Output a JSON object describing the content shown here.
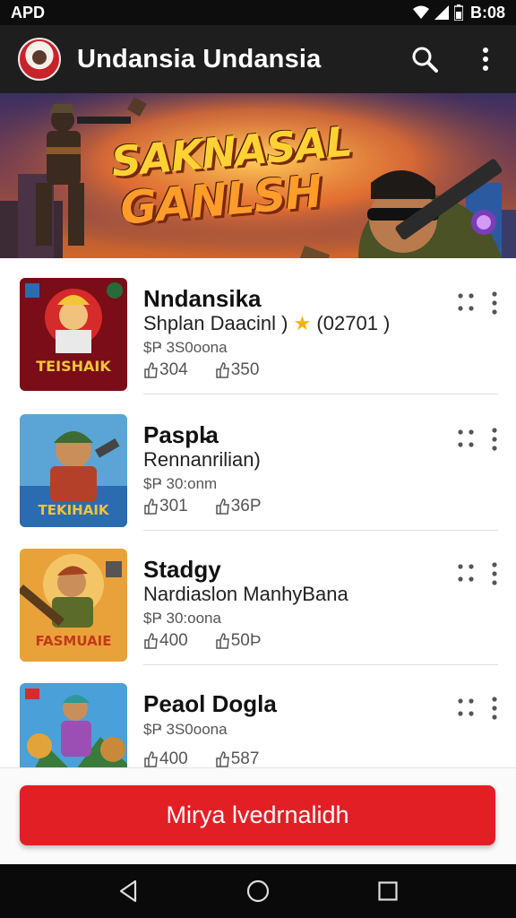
{
  "status_bar": {
    "left_text": "APD",
    "time": "B:08",
    "icons": [
      "wifi-icon",
      "signal-icon",
      "battery-icon"
    ]
  },
  "app_bar": {
    "title": "Undansia Undansia",
    "actions": [
      "search-icon",
      "more-vert-icon"
    ]
  },
  "banner": {
    "title_line1": "SAKNASAL",
    "title_line2": "GANLSH"
  },
  "games": [
    {
      "title": "Nndansika",
      "subtitle_prefix": "Shplan Daacinl )",
      "rating_icon": "star-icon",
      "rating_text": "(02701 )",
      "meta": "$Ҏ 3S0oona",
      "stat1": "304",
      "stat2": "350",
      "thumb_text": "TEISHAIK",
      "thumb_colors": [
        "#7a0d18",
        "#d62b2b",
        "#f2c43a"
      ]
    },
    {
      "title": "Paspl̵a",
      "subtitle_prefix": "Rennanrilian)",
      "meta": "$Ҏ 30:onm",
      "stat1": "301",
      "stat2": "36P",
      "thumb_text": "TEKIHAIK",
      "thumb_colors": [
        "#2b6cb0",
        "#5aa5d6",
        "#e0782c"
      ]
    },
    {
      "title": "Stadgy",
      "subtitle_prefix": "Nardiaslon ManhyBana",
      "meta": "$Ҏ 30:oona",
      "stat1": "400",
      "stat2": "50Þ",
      "thumb_text": "FASMUAIE",
      "thumb_colors": [
        "#c7632a",
        "#e9a23a",
        "#5a3b1c"
      ]
    },
    {
      "title": "Peaol Dogla",
      "subtitle_prefix": "",
      "meta": "$Ҏ 3S0oona",
      "stat1": "400",
      "stat2": "587",
      "thumb_text": "",
      "thumb_colors": [
        "#4aa0d8",
        "#9b4fb4",
        "#e2a33a"
      ]
    }
  ],
  "cta": {
    "label": "Mirya lvedrnalidh"
  },
  "nav_bar": {
    "buttons": [
      "back-icon",
      "home-icon",
      "recents-icon"
    ]
  },
  "colors": {
    "accent": "#e31f26",
    "app_bar": "#1e1e1e",
    "status_bar": "#0d0d0d"
  }
}
